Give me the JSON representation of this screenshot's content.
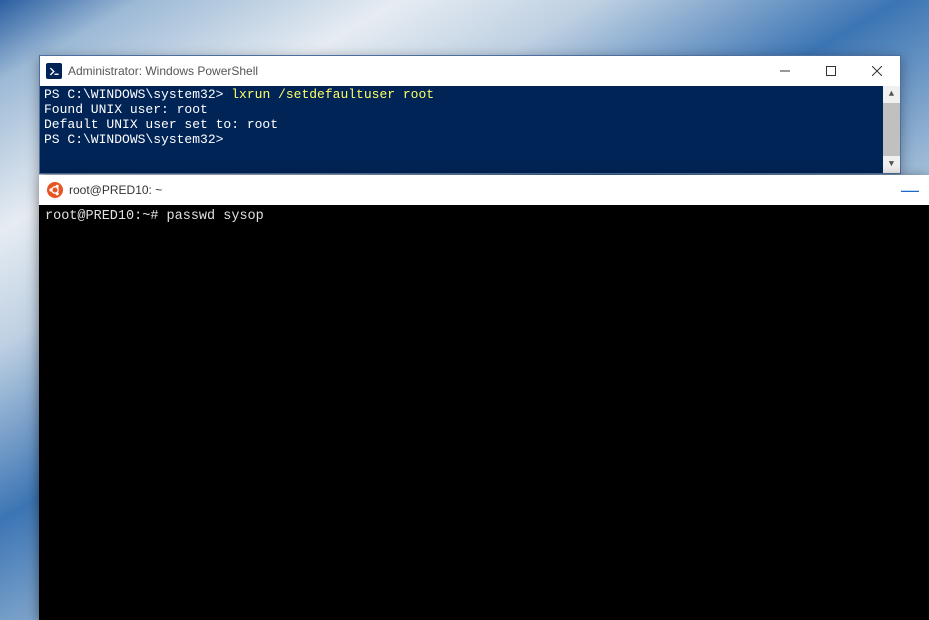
{
  "powershell": {
    "title": "Administrator: Windows PowerShell",
    "prompt1": "PS C:\\WINDOWS\\system32> ",
    "command1": "lxrun /setdefaultuser root",
    "line2": "Found UNIX user: root",
    "line3": "Default UNIX user set to: root",
    "prompt2": "PS C:\\WINDOWS\\system32>"
  },
  "ubuntu": {
    "title": "root@PRED10: ~",
    "prompt": "root@PRED10:~# ",
    "command": "passwd sysop"
  }
}
